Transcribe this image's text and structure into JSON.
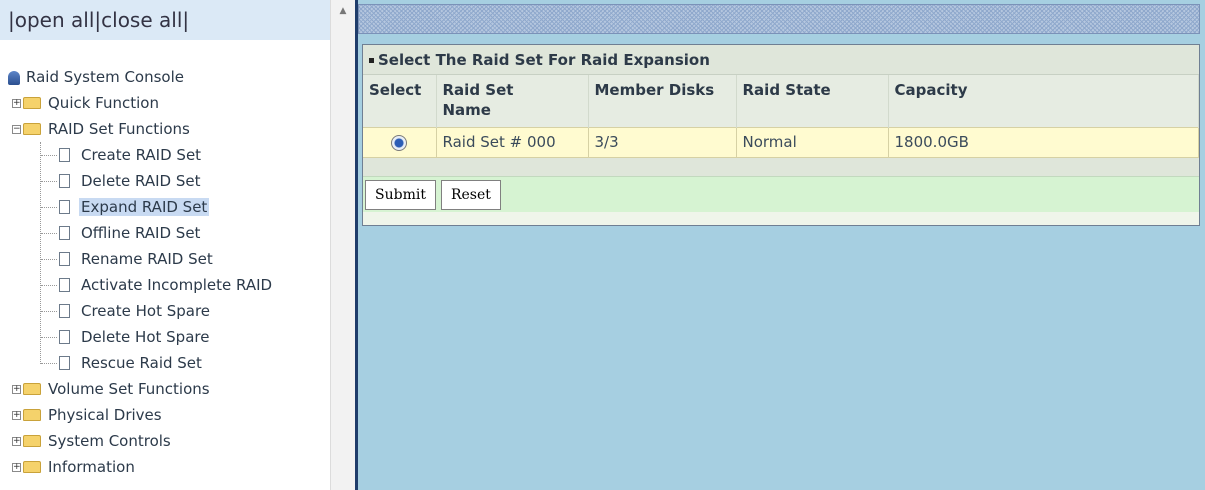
{
  "tree_header": {
    "open_all": "open all",
    "close_all": "close all"
  },
  "tree": {
    "root": "Raid System Console",
    "folders": [
      {
        "label": "Quick Function",
        "expanded": false
      },
      {
        "label": "RAID Set Functions",
        "expanded": true,
        "children": [
          "Create RAID Set",
          "Delete RAID Set",
          "Expand RAID Set",
          "Offline RAID Set",
          "Rename RAID Set",
          "Activate Incomplete RAID",
          "Create Hot Spare",
          "Delete Hot Spare",
          "Rescue Raid Set"
        ],
        "selected": "Expand RAID Set"
      },
      {
        "label": "Volume Set Functions",
        "expanded": false
      },
      {
        "label": "Physical Drives",
        "expanded": false
      },
      {
        "label": "System Controls",
        "expanded": false
      },
      {
        "label": "Information",
        "expanded": false
      }
    ]
  },
  "panel": {
    "title": "Select The Raid Set For Raid Expansion",
    "columns": [
      "Select",
      "Raid Set Name",
      "Member Disks",
      "Raid State",
      "Capacity"
    ],
    "rows": [
      {
        "selected": true,
        "name": "Raid Set # 000",
        "member_disks": "3/3",
        "state": "Normal",
        "capacity": "1800.0GB"
      }
    ],
    "submit_label": "Submit",
    "reset_label": "Reset"
  },
  "colors": {
    "right_background": "#a6cfe1",
    "row_highlight": "#fffbd0",
    "button_row": "#d6f3d2"
  }
}
